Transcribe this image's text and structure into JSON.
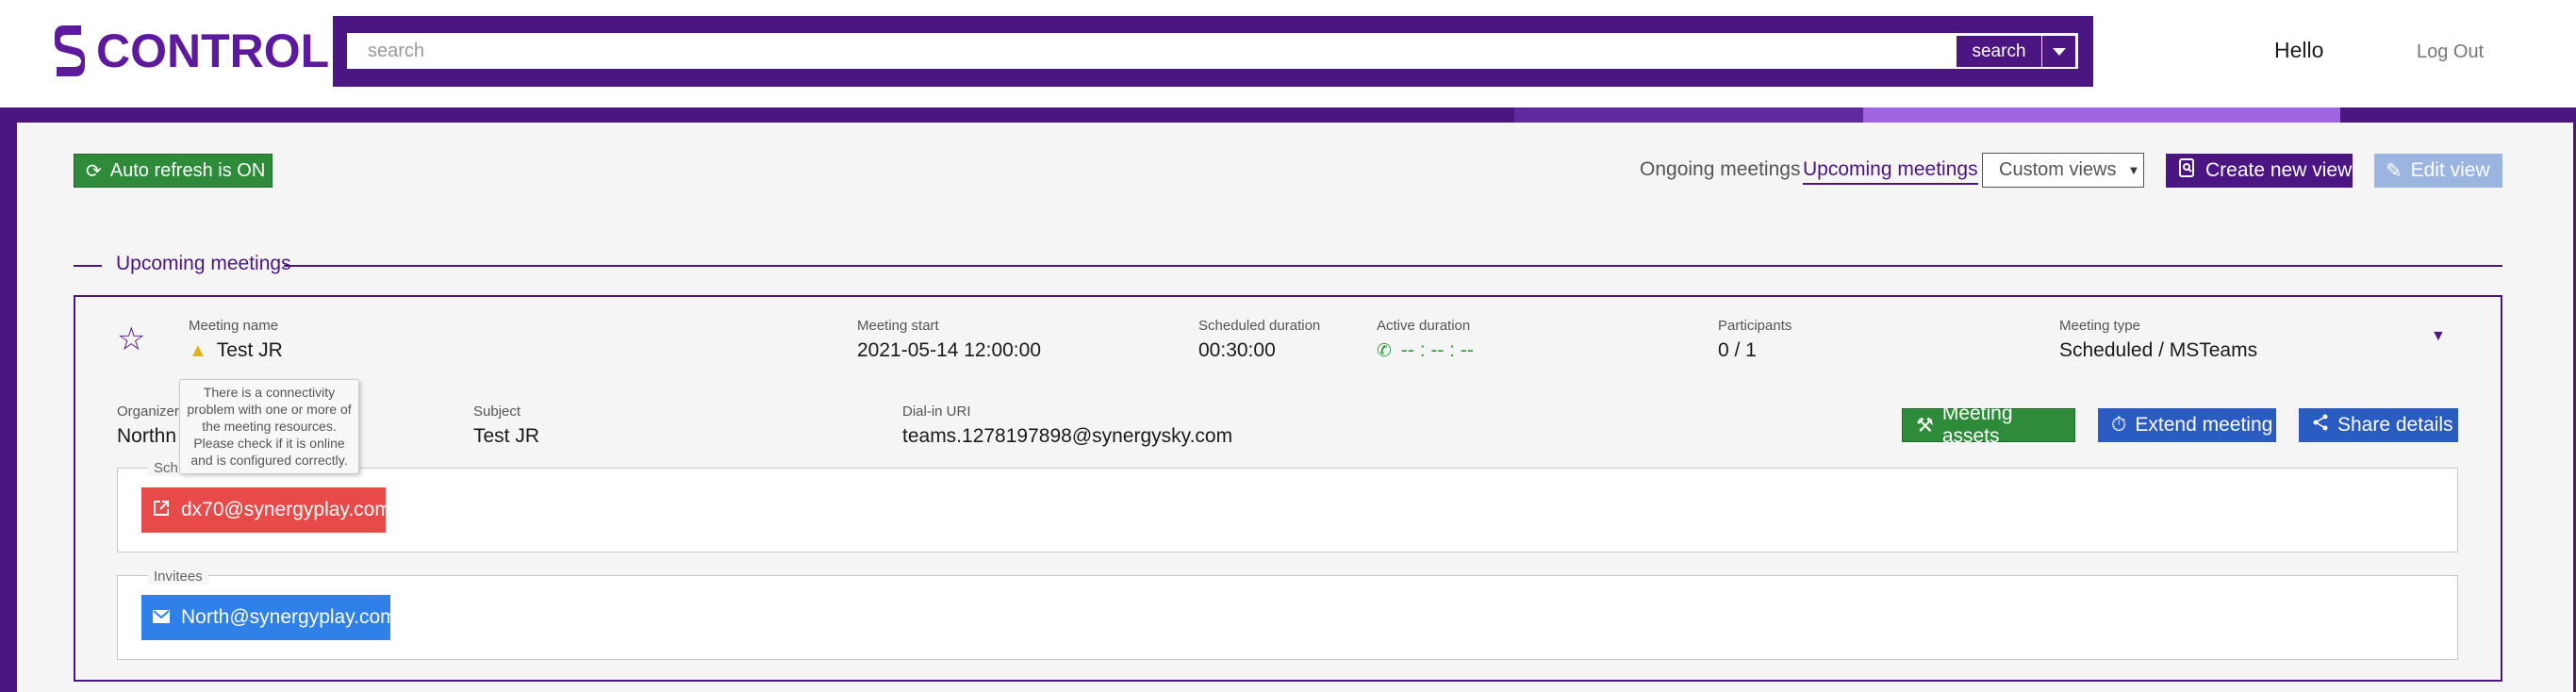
{
  "header": {
    "logo_text": "CONTROL",
    "search_placeholder": "search",
    "search_button": "search",
    "hello": "Hello",
    "logout": "Log Out"
  },
  "toolbar": {
    "auto_refresh": "Auto refresh is ON",
    "tabs": [
      "Ongoing meetings",
      "Upcoming meetings"
    ],
    "active_tab": "Upcoming meetings",
    "custom_views": "Custom views",
    "create_view": "Create new view",
    "edit_view": "Edit view"
  },
  "section": {
    "title": "Upcoming meetings"
  },
  "meeting": {
    "name_label": "Meeting name",
    "name": "Test JR",
    "start_label": "Meeting start",
    "start": "2021-05-14 12:00:00",
    "scheduled_label": "Scheduled duration",
    "scheduled": "00:30:00",
    "active_label": "Active duration",
    "active": "-- : -- : --",
    "participants_label": "Participants",
    "participants": "0 / 1",
    "type_label": "Meeting type",
    "type": "Scheduled / MSTeams",
    "organizer_label": "Organizer",
    "organizer_partial": "Northn",
    "subject_label": "Subject",
    "subject": "Test JR",
    "dialin_label": "Dial-in URI",
    "dialin": "teams.1278197898@synergysky.com",
    "tooltip_lines": [
      "There is a connectivity",
      "problem with one or more of",
      "the meeting resources.",
      "Please check if it is online",
      "and is configured correctly."
    ],
    "buttons": {
      "assets": "Meeting assets",
      "extend": "Extend meeting",
      "share": "Share details"
    },
    "scheduled_by_legend": "Sch",
    "organizer_email": "dx70@synergyplay.com",
    "invitees_legend": "Invitees",
    "invitee_email": "North@synergyplay.com"
  },
  "colors": {
    "brand": "#4b1582",
    "green": "#2e8b3a",
    "blue": "#2a5bc0",
    "red": "#e84a4a"
  }
}
